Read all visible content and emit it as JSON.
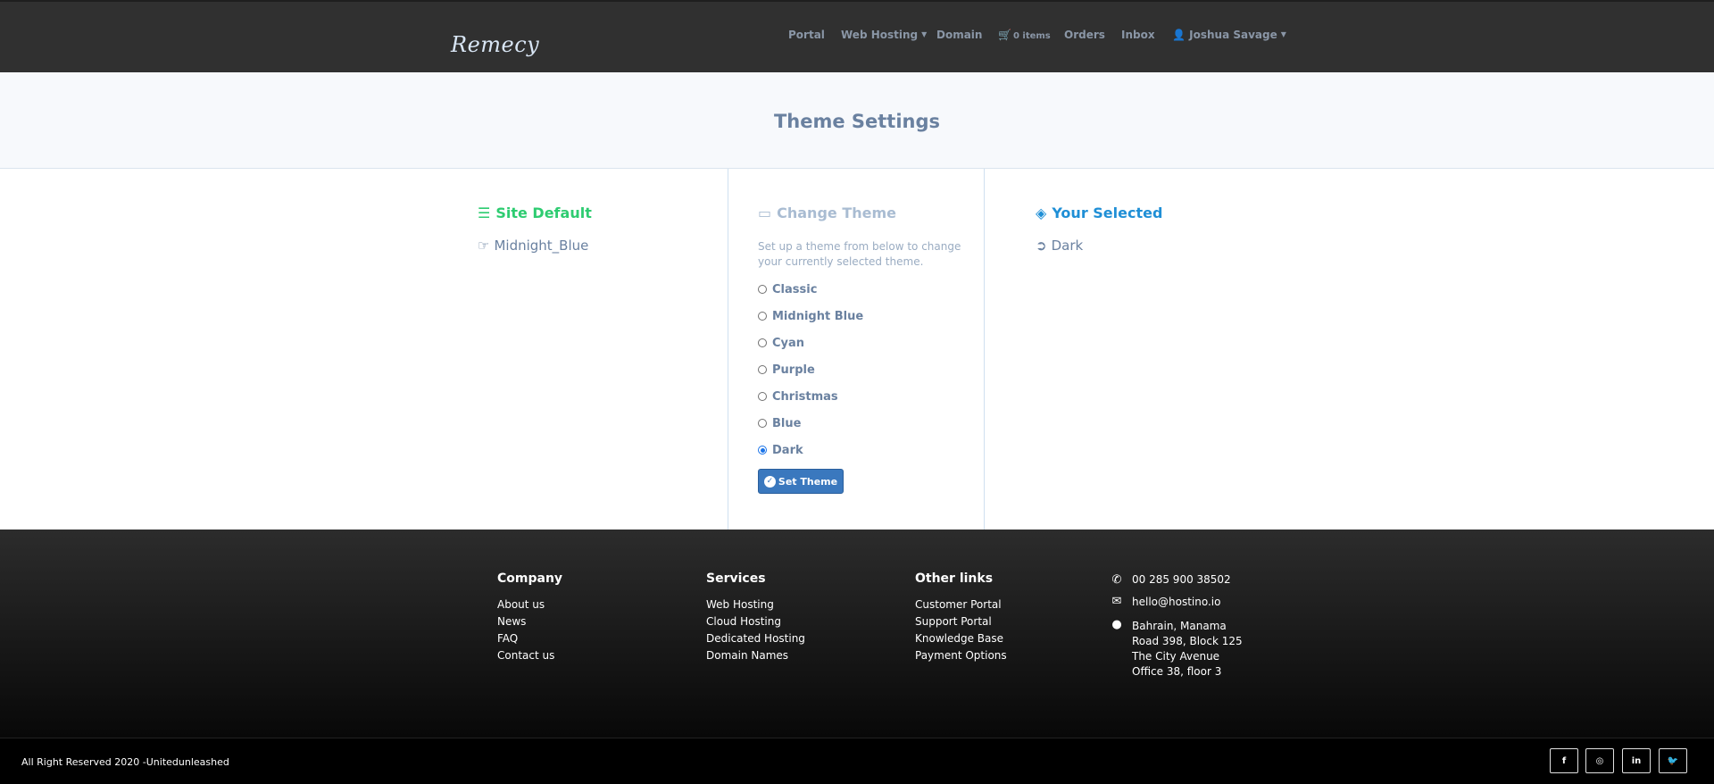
{
  "header": {
    "logo": "Remecy",
    "nav": {
      "portal": "Portal",
      "web_hosting": "Web Hosting",
      "domain": "Domain",
      "cart": "0 items",
      "orders": "Orders",
      "inbox": "Inbox",
      "user": "Joshua Savage"
    }
  },
  "page_title": "Theme Settings",
  "site_default": {
    "title": "Site Default",
    "value": "Midnight_Blue",
    "color": "#2ecc71"
  },
  "change_theme": {
    "title": "Change Theme",
    "description": "Set up a theme from below to change your currently selected theme.",
    "options": [
      "Classic",
      "Midnight Blue",
      "Cyan",
      "Purple",
      "Christmas",
      "Blue",
      "Dark"
    ],
    "selected": "Dark",
    "button": "Set Theme"
  },
  "your_selected": {
    "title": "Your Selected",
    "value": "Dark",
    "color": "#1f8fd6"
  },
  "footer": {
    "company": {
      "heading": "Company",
      "links": [
        "About us",
        "News",
        "FAQ",
        "Contact us"
      ]
    },
    "services": {
      "heading": "Services",
      "links": [
        "Web Hosting",
        "Cloud Hosting",
        "Dedicated Hosting",
        "Domain Names"
      ]
    },
    "other": {
      "heading": "Other links",
      "links": [
        "Customer Portal",
        "Support Portal",
        "Knowledge Base",
        "Payment Options"
      ]
    },
    "contact": {
      "phone": "00 285 900 38502",
      "email": "hello@hostino.io",
      "address": [
        "Bahrain, Manama",
        "Road 398, Block 125",
        "The City Avenue",
        "Office 38, floor 3"
      ]
    },
    "copyright": "All Right Reserved 2020 -Unitedunleashed",
    "social": [
      "facebook-icon",
      "instagram-icon",
      "linkedin-icon",
      "twitter-icon"
    ]
  }
}
